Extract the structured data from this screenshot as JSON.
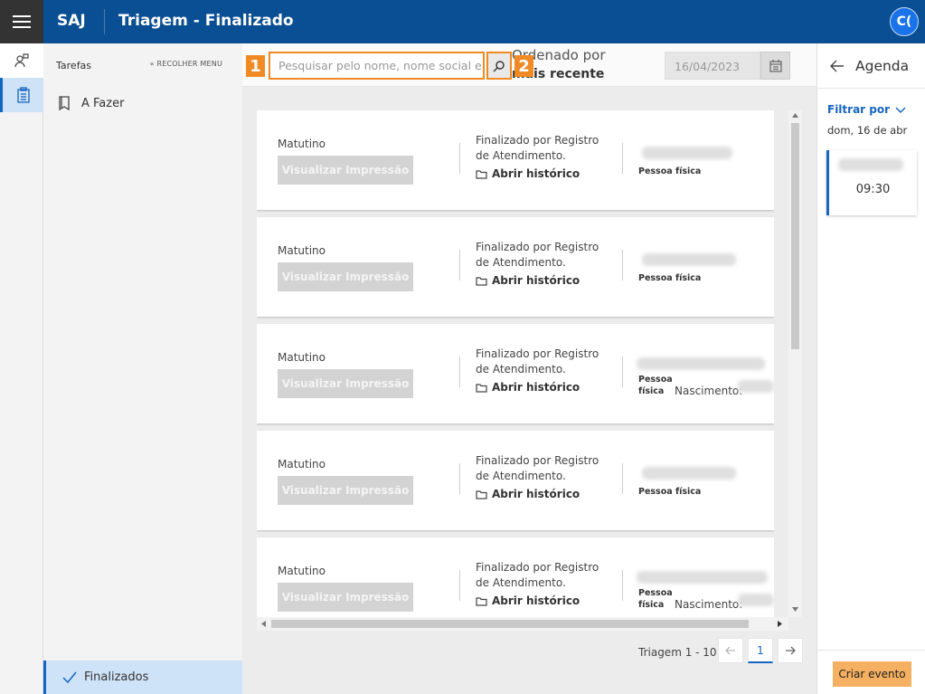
{
  "app": {
    "brand": "SAJ",
    "title": "Triagem - Finalizado",
    "avatar": "C("
  },
  "sidebar": {
    "header": "Tarefas",
    "collapse_label": "« RECOLHER MENU",
    "todo_label": "A Fazer",
    "done_label": "Finalizados"
  },
  "toolbar": {
    "search_placeholder": "Pesquisar pelo nome, nome social e",
    "callout_1": "1",
    "callout_2": "2",
    "order_label": "Ordenado por",
    "order_value": "mais recente",
    "date_value": "16/04/2023"
  },
  "cards": [
    {
      "shift": "Matutino",
      "button": "Visualizar Impressão",
      "status": "Finalizado por Registro de Atendimento.",
      "history": "Abrir histórico",
      "person_type": "Pessoa física",
      "birth_label": ""
    },
    {
      "shift": "Matutino",
      "button": "Visualizar Impressão",
      "status": "Finalizado por Registro de Atendimento.",
      "history": "Abrir histórico",
      "person_type": "Pessoa física",
      "birth_label": ""
    },
    {
      "shift": "Matutino",
      "button": "Visualizar Impressão",
      "status": "Finalizado por Registro de Atendimento.",
      "history": "Abrir histórico",
      "person_type": "Pessoa física",
      "birth_label": "Nascimento:"
    },
    {
      "shift": "Matutino",
      "button": "Visualizar Impressão",
      "status": "Finalizado por Registro de Atendimento.",
      "history": "Abrir histórico",
      "person_type": "Pessoa física",
      "birth_label": ""
    },
    {
      "shift": "Matutino",
      "button": "Visualizar Impressão",
      "status": "Finalizado por Registro de Atendimento.",
      "history": "Abrir histórico",
      "person_type": "Pessoa física",
      "birth_label": "Nascimento:"
    }
  ],
  "pagination": {
    "label": "Triagem 1 - 10",
    "current": "1"
  },
  "agenda": {
    "title": "Agenda",
    "filter_label": "Filtrar por",
    "date": "dom, 16 de abr",
    "event_time": "09:30",
    "create_button": "Criar evento"
  },
  "colors": {
    "header": "#0a4e93",
    "accent": "#1565c0",
    "highlight": "#f08a24",
    "create": "#f5b061"
  }
}
